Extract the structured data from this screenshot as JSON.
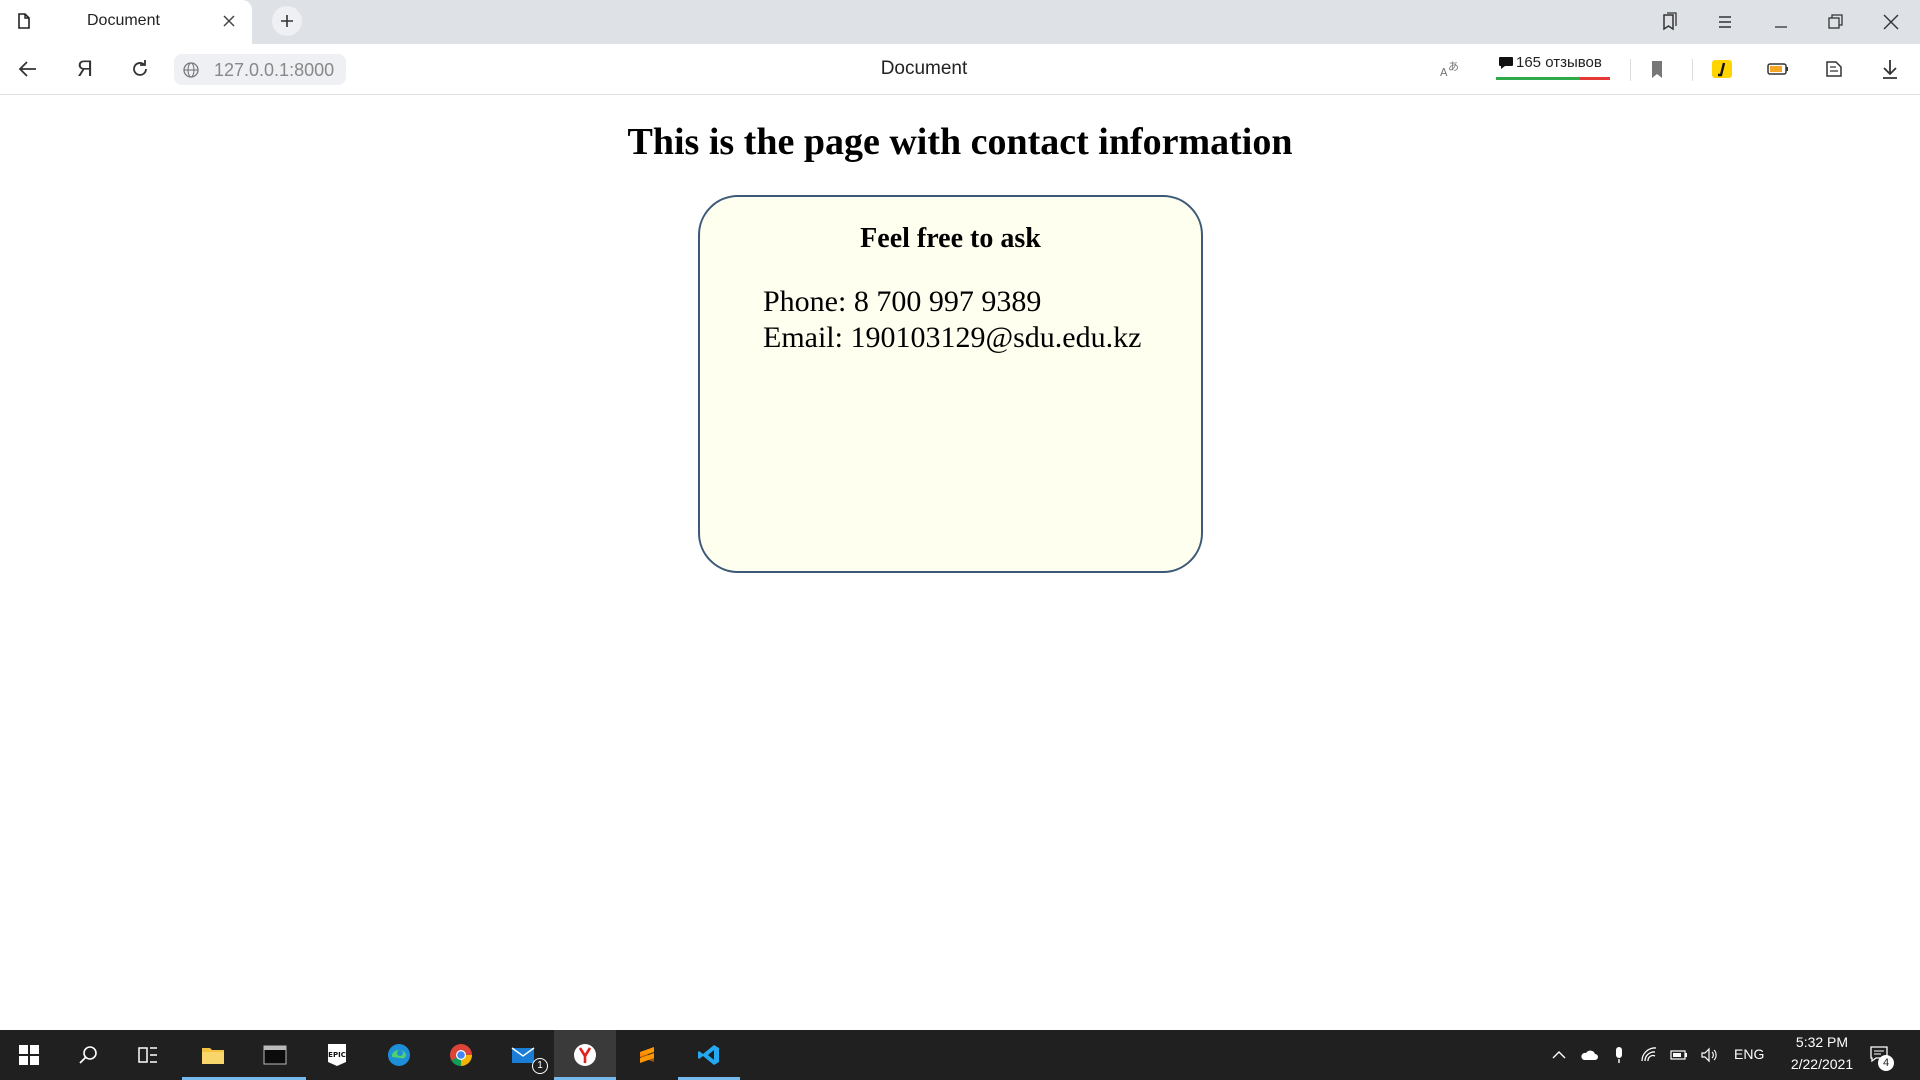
{
  "browser": {
    "tab_title": "Document",
    "address": "127.0.0.1:8000",
    "page_title": "Document",
    "yandex_letter": "Я",
    "reviews_label": "165 отзывов"
  },
  "page": {
    "heading": "This is the page with contact information",
    "contact_box": {
      "heading": "Feel free to ask",
      "phone": "Phone: 8 700 997 9389",
      "email": "Email: 190103129@sdu.edu.kz",
      "background": "#fffff0",
      "border_color": "#3c5a78"
    }
  },
  "taskbar": {
    "apps": [
      {
        "name": "file-explorer",
        "icon": "folder-icon"
      },
      {
        "name": "terminal",
        "icon": "terminal-icon"
      },
      {
        "name": "epic-games",
        "icon": "epic-games-icon",
        "label": "EPIC"
      },
      {
        "name": "edge",
        "icon": "edge-icon"
      },
      {
        "name": "chrome",
        "icon": "chrome-icon"
      },
      {
        "name": "mail",
        "icon": "mail-icon",
        "badge": "1"
      },
      {
        "name": "yandex-browser",
        "icon": "yandex-icon"
      },
      {
        "name": "sublime-text",
        "icon": "sublime-icon"
      },
      {
        "name": "vscode",
        "icon": "vscode-icon"
      }
    ],
    "language": "ENG",
    "time": "5:32 PM",
    "date": "2/22/2021",
    "notification_count": "4"
  }
}
